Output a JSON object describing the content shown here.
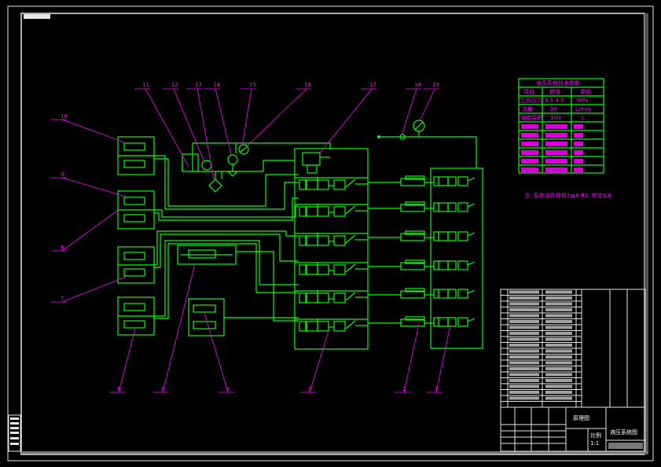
{
  "callouts": [
    "1",
    "2",
    "3",
    "4",
    "5",
    "6",
    "7",
    "8",
    "9",
    "10",
    "11",
    "12",
    "13",
    "14",
    "15",
    "16",
    "17",
    "18",
    "19"
  ],
  "note": "注: 系统油管规格为φ8-R2, 额定3.6",
  "param_table": {
    "title": "液压系统技术参数",
    "headers": [
      "项目",
      "数值",
      "单位"
    ],
    "rows": [
      [
        "工作压力",
        "0.5-4.5",
        "MPa"
      ],
      [
        "流量",
        "20",
        "L/min"
      ],
      [
        "油箱容积",
        "100",
        "L"
      ]
    ]
  },
  "title_block": {
    "drawing_name": "液压系统图",
    "label_left": "原理图",
    "scale_label": "比例",
    "scale_value": "1:1"
  },
  "colors": {
    "line": "#00ff00",
    "callout": "#ff00ff",
    "frame": "#e6e6e6",
    "background": "#000000"
  }
}
